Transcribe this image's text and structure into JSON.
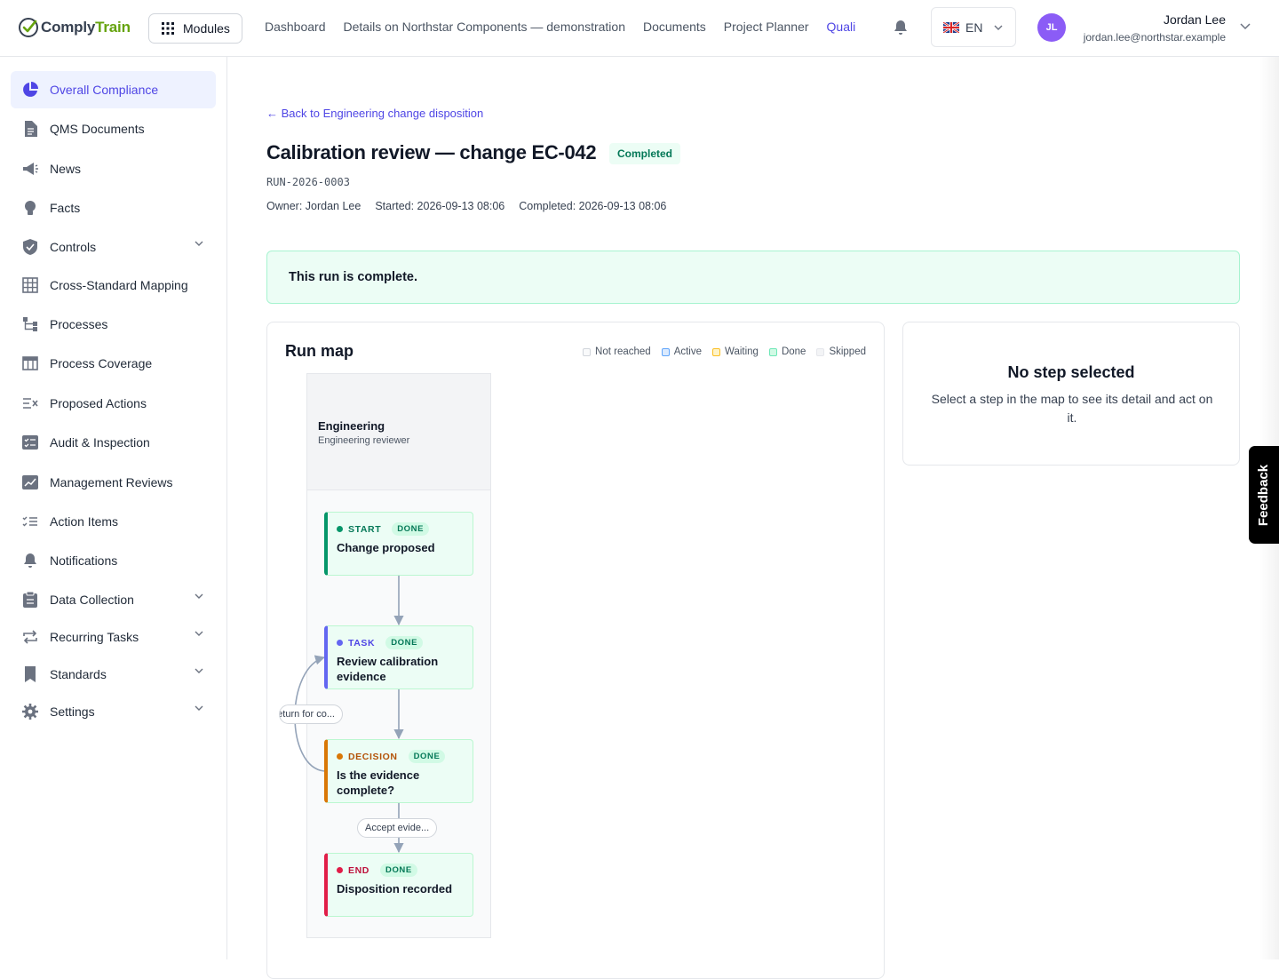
{
  "header": {
    "logo_comply": "Comply",
    "logo_train": "Train",
    "modules_label": "Modules",
    "nav": [
      "Dashboard",
      "Details on Northstar Components — demonstration",
      "Documents",
      "Project Planner",
      "Quali"
    ],
    "lang_code": "EN",
    "user": {
      "initials": "JL",
      "name": "Jordan Lee",
      "email": "jordan.lee@northstar.example"
    }
  },
  "sidebar": {
    "items": [
      {
        "label": "Overall Compliance",
        "icon": "pie-chart-icon",
        "active": true
      },
      {
        "label": "QMS Documents",
        "icon": "document-icon"
      },
      {
        "label": "News",
        "icon": "megaphone-icon"
      },
      {
        "label": "Facts",
        "icon": "lightbulb-icon"
      },
      {
        "label": "Controls",
        "icon": "shield-icon",
        "expandable": true
      },
      {
        "label": "Cross-Standard Mapping",
        "icon": "grid-icon"
      },
      {
        "label": "Processes",
        "icon": "process-tree-icon"
      },
      {
        "label": "Process Coverage",
        "icon": "table-icon"
      },
      {
        "label": "Proposed Actions",
        "icon": "list-x-icon"
      },
      {
        "label": "Audit & Inspection",
        "icon": "checklist-icon"
      },
      {
        "label": "Management Reviews",
        "icon": "chart-icon"
      },
      {
        "label": "Action Items",
        "icon": "checklist-lines-icon"
      },
      {
        "label": "Notifications",
        "icon": "bell-icon"
      },
      {
        "label": "Data Collection",
        "icon": "clipboard-icon",
        "expandable": true
      },
      {
        "label": "Recurring Tasks",
        "icon": "repeat-icon",
        "expandable": true
      },
      {
        "label": "Standards",
        "icon": "bookmark-icon",
        "expandable": true
      },
      {
        "label": "Settings",
        "icon": "gear-icon",
        "expandable": true
      }
    ]
  },
  "page": {
    "back_link": "← Back to Engineering change disposition",
    "title": "Calibration review — change EC-042",
    "status": "Completed",
    "run_id": "RUN-2026-0003",
    "owner": "Owner: Jordan Lee",
    "started": "Started: 2026-09-13 08:06",
    "completed": "Completed: 2026-09-13 08:06",
    "banner": "This run is complete."
  },
  "run_map": {
    "title": "Run map",
    "legend": [
      {
        "label": "Not reached",
        "fill": "#f9fafb",
        "border": "#d1d5db"
      },
      {
        "label": "Active",
        "fill": "#dbeafe",
        "border": "#60a5fa"
      },
      {
        "label": "Waiting",
        "fill": "#fef3c7",
        "border": "#fbbf24"
      },
      {
        "label": "Done",
        "fill": "#d1fae5",
        "border": "#6ee7b7"
      },
      {
        "label": "Skipped",
        "fill": "#f3f4f6",
        "border": "#e5e7eb"
      }
    ],
    "lane": {
      "name": "Engineering",
      "role": "Engineering reviewer"
    },
    "status_label": "DONE",
    "nodes": [
      {
        "kind": "START",
        "label": "Change proposed",
        "color": "#059669"
      },
      {
        "kind": "TASK",
        "label": "Review calibration evidence",
        "color": "#6366f1"
      },
      {
        "kind": "DECISION",
        "label": "Is the evidence complete?",
        "color": "#d97706"
      },
      {
        "kind": "END",
        "label": "Disposition recorded",
        "color": "#e11d48"
      }
    ],
    "edge_labels": {
      "loop": "Return for co...",
      "accept": "Accept evide..."
    }
  },
  "detail": {
    "title": "No step selected",
    "body": "Select a step in the map to see its detail and act on it."
  },
  "feedback": "Feedback"
}
